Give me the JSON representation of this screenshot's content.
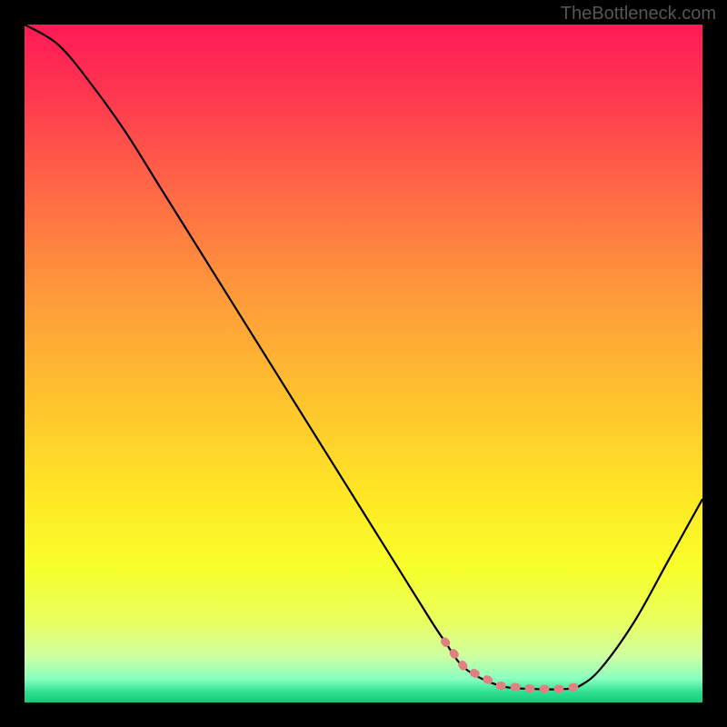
{
  "watermark": "TheBottleneck.com",
  "chart_data": {
    "type": "line",
    "title": "",
    "xlabel": "",
    "ylabel": "",
    "xlim": [
      0,
      100
    ],
    "ylim": [
      0,
      100
    ],
    "series": [
      {
        "name": "bottleneck-curve",
        "x": [
          0,
          5,
          10,
          15,
          20,
          25,
          30,
          35,
          40,
          45,
          50,
          55,
          60,
          62,
          65,
          70,
          75,
          80,
          82,
          85,
          90,
          95,
          100
        ],
        "y": [
          100,
          97,
          91,
          84,
          76,
          68,
          60,
          52,
          44,
          36,
          28,
          20,
          12,
          9,
          5,
          2.5,
          2,
          2,
          2.5,
          5,
          12,
          21,
          30
        ]
      }
    ],
    "optimal_region": {
      "x_start": 62,
      "x_end": 82,
      "y": 2
    },
    "gradient_stops": [
      {
        "offset": 0.0,
        "color": "#ff1a55"
      },
      {
        "offset": 0.1,
        "color": "#ff3650"
      },
      {
        "offset": 0.25,
        "color": "#ff6a45"
      },
      {
        "offset": 0.4,
        "color": "#ff9a3a"
      },
      {
        "offset": 0.55,
        "color": "#ffc22f"
      },
      {
        "offset": 0.7,
        "color": "#ffe825"
      },
      {
        "offset": 0.8,
        "color": "#f8ff2a"
      },
      {
        "offset": 0.88,
        "color": "#eaff60"
      },
      {
        "offset": 0.93,
        "color": "#d0ffa0"
      },
      {
        "offset": 0.965,
        "color": "#8affc0"
      },
      {
        "offset": 0.985,
        "color": "#2ee090"
      },
      {
        "offset": 1.0,
        "color": "#18c878"
      }
    ]
  }
}
